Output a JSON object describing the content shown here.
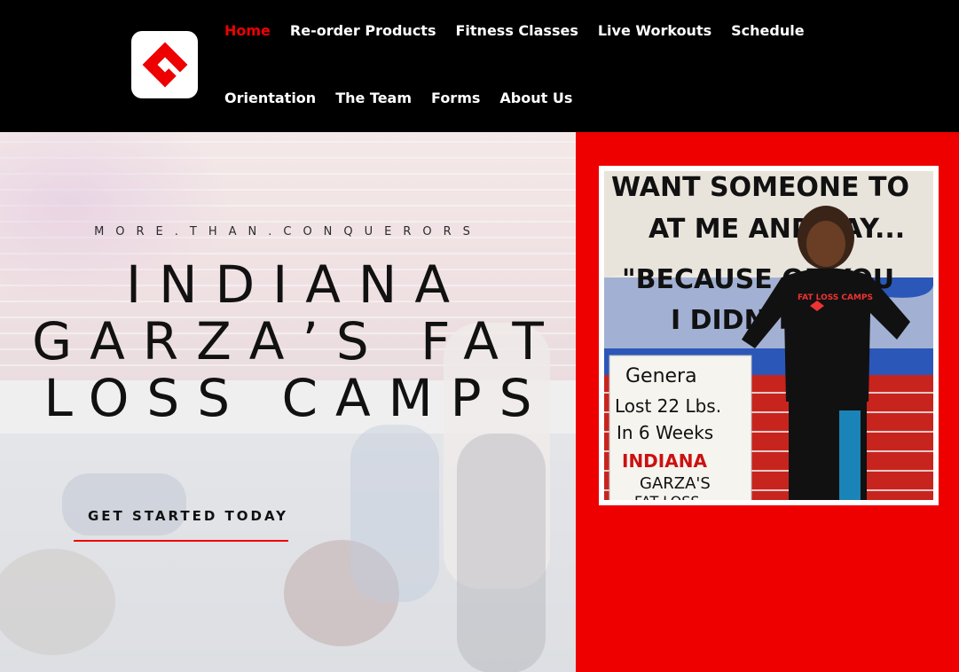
{
  "header": {
    "logo": {
      "icon": "garza-g-logo",
      "brand_color": "#ee0000"
    },
    "nav": {
      "row1": [
        {
          "label": "Home",
          "active": true
        },
        {
          "label": "Re-order Products",
          "active": false
        },
        {
          "label": "Fitness Classes",
          "active": false
        },
        {
          "label": "Live Workouts",
          "active": false
        },
        {
          "label": "Schedule",
          "active": false
        }
      ],
      "row2": [
        {
          "label": "Orientation",
          "active": false
        },
        {
          "label": "The Team",
          "active": false
        },
        {
          "label": "Forms",
          "active": false
        },
        {
          "label": "About Us",
          "active": false
        }
      ]
    }
  },
  "hero": {
    "tagline": "MORE.THAN.CONQUERORS",
    "title_lines": [
      "INDIANA",
      "GARZA’S FAT",
      "LOSS CAMPS"
    ],
    "cta_label": "GET STARTED TODAY",
    "accent_color": "#ee0000"
  },
  "side_photo": {
    "wall_text": [
      "WANT SOMEONE TO",
      "AT ME AND SAY...",
      "\"BECAUSE OF YOU",
      "I DIDN'T"
    ],
    "sign_lines": [
      "Genera",
      "Lost 22 Lbs.",
      "In 6 Weeks",
      "INDIANA",
      "GARZA'S",
      "FAT LOSS"
    ],
    "shirt_text": "FAT LOSS CAMPS"
  }
}
